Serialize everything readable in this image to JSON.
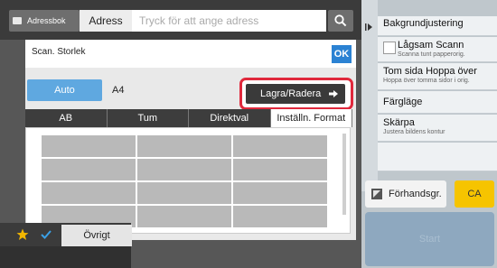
{
  "topbar": {
    "address_book_label": "Adressbok",
    "address_label": "Adress",
    "address_placeholder": "Tryck för att ange adress",
    "search_icon": "search-icon"
  },
  "dialog": {
    "title": "Scan. Storlek",
    "ok_label": "OK",
    "auto_label": "Auto",
    "size_value": "A4",
    "save_delete_label": "Lagra/Radera",
    "tabs": [
      {
        "label": "AB",
        "active": false
      },
      {
        "label": "Tum",
        "active": false
      },
      {
        "label": "Direktval",
        "active": false
      },
      {
        "label": "Inställn. Format",
        "active": true
      }
    ]
  },
  "sidebar": {
    "items": [
      {
        "title": "Bakgrundjustering",
        "sub": ""
      },
      {
        "title": "Lågsam Scann",
        "sub": "Scanna tunt papperorig.",
        "checkbox": true
      },
      {
        "title": "Tom sida Hoppa över",
        "sub": "Hoppa över tomma sidor i orig."
      },
      {
        "title": "Färgläge",
        "sub": ""
      },
      {
        "title": "Skärpa",
        "sub": "Justera bildens kontur"
      }
    ],
    "preview_label": "Förhandsgr.",
    "ca_label": "CA",
    "start_label": "Start"
  },
  "bottombar": {
    "other_label": "Övrigt"
  },
  "colors": {
    "accent_blue": "#2b82d3",
    "auto_blue": "#5fa8e0",
    "highlight_red": "#e0283c",
    "ca_yellow": "#f6c400",
    "start_blue": "#8ea8bf"
  }
}
